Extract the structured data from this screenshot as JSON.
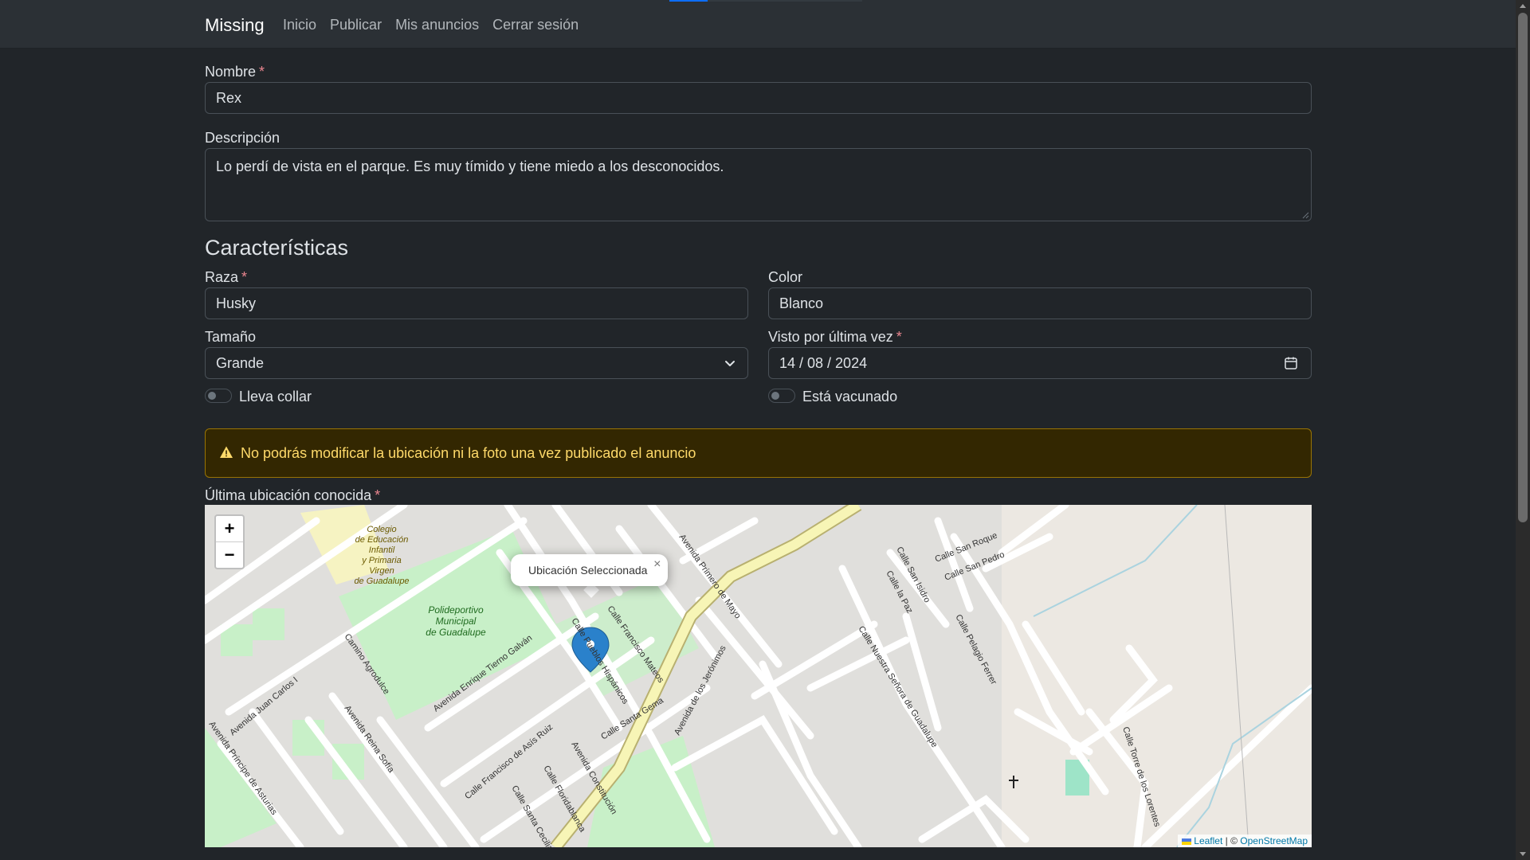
{
  "navbar": {
    "brand": "Missing",
    "links": [
      "Inicio",
      "Publicar",
      "Mis anuncios",
      "Cerrar sesión"
    ]
  },
  "form": {
    "nombre": {
      "label": "Nombre",
      "required": "*",
      "value": "Rex"
    },
    "descripcion": {
      "label": "Descripción",
      "value": "Lo perdí de vista en el parque. Es muy tímido y tiene miedo a los desconocidos."
    },
    "section_title": "Características",
    "raza": {
      "label": "Raza",
      "required": "*",
      "value": "Husky"
    },
    "color": {
      "label": "Color",
      "value": "Blanco"
    },
    "tamano": {
      "label": "Tamaño",
      "value": "Grande"
    },
    "visto": {
      "label": "Visto por última vez",
      "required": "*",
      "value": "14 / 08 / 2024"
    },
    "collar": {
      "label": "Lleva collar",
      "checked": false
    },
    "vacunado": {
      "label": "Está vacunado",
      "checked": false
    },
    "alert_text": "No podrás modificar la ubicación ni la foto una vez publicado el anuncio",
    "ubicacion": {
      "label": "Última ubicación conocida",
      "required": "*"
    }
  },
  "map": {
    "zoom_in": "+",
    "zoom_out": "−",
    "popup_text": "Ubicación Seleccionada",
    "popup_close": "×",
    "attribution_leaflet": "Leaflet",
    "attribution_sep": "| ©",
    "attribution_osm": "OpenStreetMap",
    "place_labels": {
      "school": "Colegio de Educación Infantil y Primaria Virgen de Guadalupe",
      "sports": "Polideportivo Municipal de Guadalupe",
      "streets": [
        "Avenida de los Jerónimos",
        "Calle Pueblos Hispánicos",
        "Camino Agrodulce",
        "Avenida Enrique Tierno Galván",
        "Calle Francisco Mateos",
        "Avenida Primero de Mayo",
        "Calle Nuestra Señora de Guadalupe",
        "Calle San Isidro",
        "Calle San Roque",
        "Calle San Pedro",
        "Calle Pelagio Ferrer",
        "Calle Torre de los Lorentes",
        "Avenida Reina Sofía",
        "Avenida Juan Carlos I",
        "Avenida Príncipe de Asturias",
        "Calle Francisco de Asís Ruiz",
        "Calle Santa Gema",
        "Avenida Constitución",
        "Calle Floridablanca",
        "Calle Santa Cecilia",
        "Calle la Paz"
      ]
    }
  },
  "colors": {
    "accent": "#0d6efd",
    "alert_bg": "#332701",
    "alert_text": "#ffda6a",
    "required": "#ea868f",
    "marker": "#2a81cb"
  }
}
